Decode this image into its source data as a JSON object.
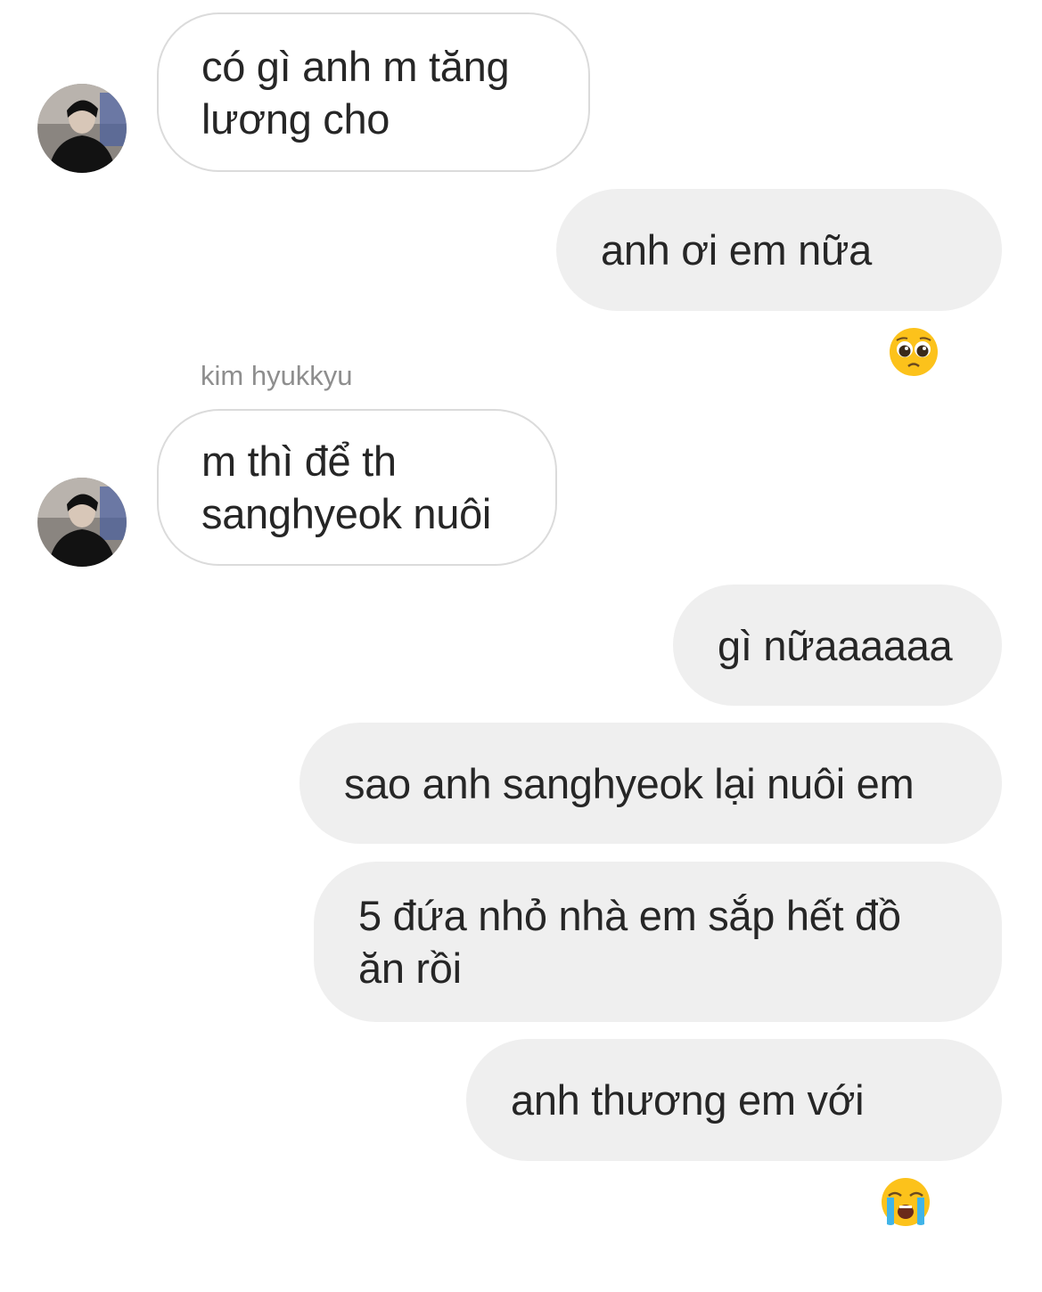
{
  "messages": [
    {
      "type": "incoming",
      "text": "có gì anh m tăng\nlương cho"
    },
    {
      "type": "outgoing",
      "text": "anh ơi em nữa",
      "emoji": "pleading-face-icon"
    },
    {
      "type": "sender_name",
      "text": "kim hyukkyu"
    },
    {
      "type": "incoming",
      "text": "m thì để th\nsanghyeok nuôi"
    },
    {
      "type": "outgoing",
      "text": "gì nữaaaaaa"
    },
    {
      "type": "outgoing",
      "text": "sao anh sanghyeok lại nuôi em"
    },
    {
      "type": "outgoing",
      "text": "5 đứa nhỏ nhà em sắp hết đồ\năn rồi"
    },
    {
      "type": "outgoing",
      "text": "anh thương em với",
      "emoji": "loudly-crying-face-icon"
    }
  ],
  "colors": {
    "incoming_bg": "#ffffff",
    "incoming_border": "#dbdbdb",
    "outgoing_bg": "#efefef",
    "text": "#262626",
    "sender_name": "#8e8e8e"
  }
}
